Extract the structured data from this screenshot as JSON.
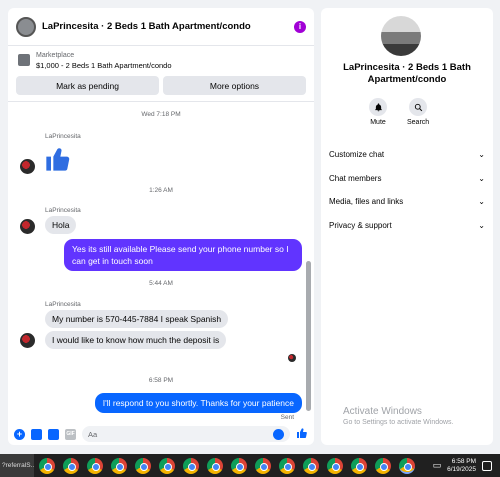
{
  "chat": {
    "title": "LaPrincesita · 2 Beds 1 Bath Apartment/condo",
    "info_icon": "i",
    "marketplace": {
      "label": "Marketplace",
      "listing": "$1,000 - 2 Beds 1 Bath Apartment/condo"
    },
    "buttons": {
      "mark_pending": "Mark as pending",
      "more_options": "More options"
    },
    "timestamps": [
      "Wed 7:18 PM",
      "1:26 AM",
      "5:44 AM",
      "6:58 PM"
    ],
    "sender_name": "LaPrincesita",
    "messages": {
      "hola": "Hola",
      "reply1": "Yes its still available Please send your phone number so I can get in touch soon",
      "number": "My number is 570-445-7884 I speak Spanish",
      "deposit": "I would like to know how much the deposit is",
      "reply2": "I'll respond to you shortly. Thanks for your patience"
    },
    "sent_label": "Sent",
    "composer_placeholder": "Aa"
  },
  "side": {
    "name": "LaPrincesita · 2 Beds 1 Bath Apartment/condo",
    "mute_label": "Mute",
    "search_label": "Search",
    "items": [
      {
        "label": "Customize chat"
      },
      {
        "label": "Chat members"
      },
      {
        "label": "Media, files and links"
      },
      {
        "label": "Privacy & support"
      }
    ],
    "activate_title": "Activate Windows",
    "activate_sub": "Go to Settings to activate Windows."
  },
  "taskbar": {
    "label": "?referralS...",
    "time": "6:58 PM",
    "date": "6/19/2025"
  }
}
